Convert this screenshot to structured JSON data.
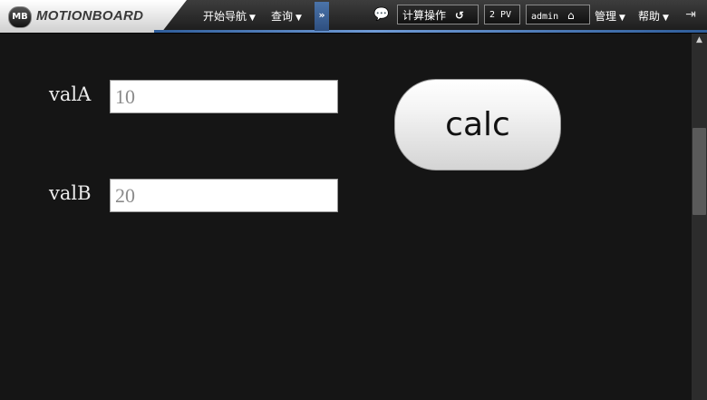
{
  "app": {
    "logo_badge": "MB",
    "logo_text": "MOTIONBOARD"
  },
  "toolbar": {
    "menu_start_nav": "开始导航",
    "menu_query": "查询",
    "more_icon": "double-chevron-down-icon",
    "chat_icon": "chat-bubble-icon",
    "calc_operation_label": "计算操作",
    "refresh_icon": "refresh-icon",
    "pv_label": "2 PV",
    "user_label": "admin",
    "home_icon": "home-icon",
    "menu_manage": "管理",
    "menu_help": "帮助",
    "logout_icon": "logout-icon",
    "accent_color": "#4b74aa"
  },
  "form": {
    "val_a_label": "valA",
    "val_a_value": "10",
    "val_b_label": "valB",
    "val_b_value": "20",
    "calc_label": "calc"
  }
}
